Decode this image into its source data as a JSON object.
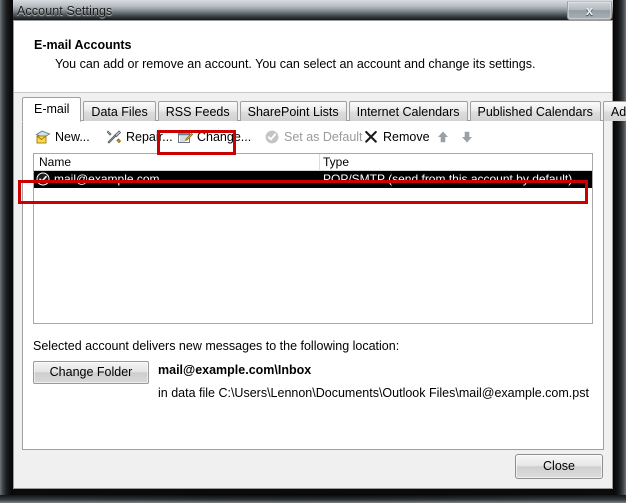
{
  "window": {
    "title": "Account Settings",
    "close_icon": "close-x-icon",
    "close_button_label": "x"
  },
  "header": {
    "title": "E-mail Accounts",
    "subtitle": "You can add or remove an account. You can select an account and change its settings."
  },
  "tabs": [
    {
      "label": "E-mail",
      "active": true
    },
    {
      "label": "Data Files",
      "active": false
    },
    {
      "label": "RSS Feeds",
      "active": false
    },
    {
      "label": "SharePoint Lists",
      "active": false
    },
    {
      "label": "Internet Calendars",
      "active": false
    },
    {
      "label": "Published Calendars",
      "active": false
    },
    {
      "label": "Address Books",
      "active": false
    }
  ],
  "toolbar": {
    "new_label": "New...",
    "new_icon": "new-mail-icon",
    "repair_label": "Repair...",
    "repair_icon": "wrench-screwdriver-icon",
    "change_label": "Change...",
    "change_icon": "change-account-icon",
    "set_default_label": "Set as Default",
    "set_default_icon": "check-circle-icon",
    "remove_label": "Remove",
    "remove_icon": "x-mark-icon",
    "move_up_icon": "arrow-up-icon",
    "move_down_icon": "arrow-down-icon"
  },
  "account_list": {
    "columns": [
      "Name",
      "Type"
    ],
    "rows": [
      {
        "icon": "default-account-check-icon",
        "name": "mail@example.com",
        "type": "POP/SMTP (send from this account by default)",
        "selected": true
      }
    ]
  },
  "delivery": {
    "label": "Selected account delivers new messages to the following location:",
    "change_folder_label": "Change Folder",
    "folder": "mail@example.com\\Inbox",
    "data_file": "in data file C:\\Users\\Lennon\\Documents\\Outlook Files\\mail@example.com.pst"
  },
  "footer": {
    "close_label": "Close"
  },
  "annotations": {
    "highlight_color": "#cc0000",
    "change_button_highlight": "Change... button highlighted",
    "account_row_highlight": "selected account row highlighted"
  }
}
